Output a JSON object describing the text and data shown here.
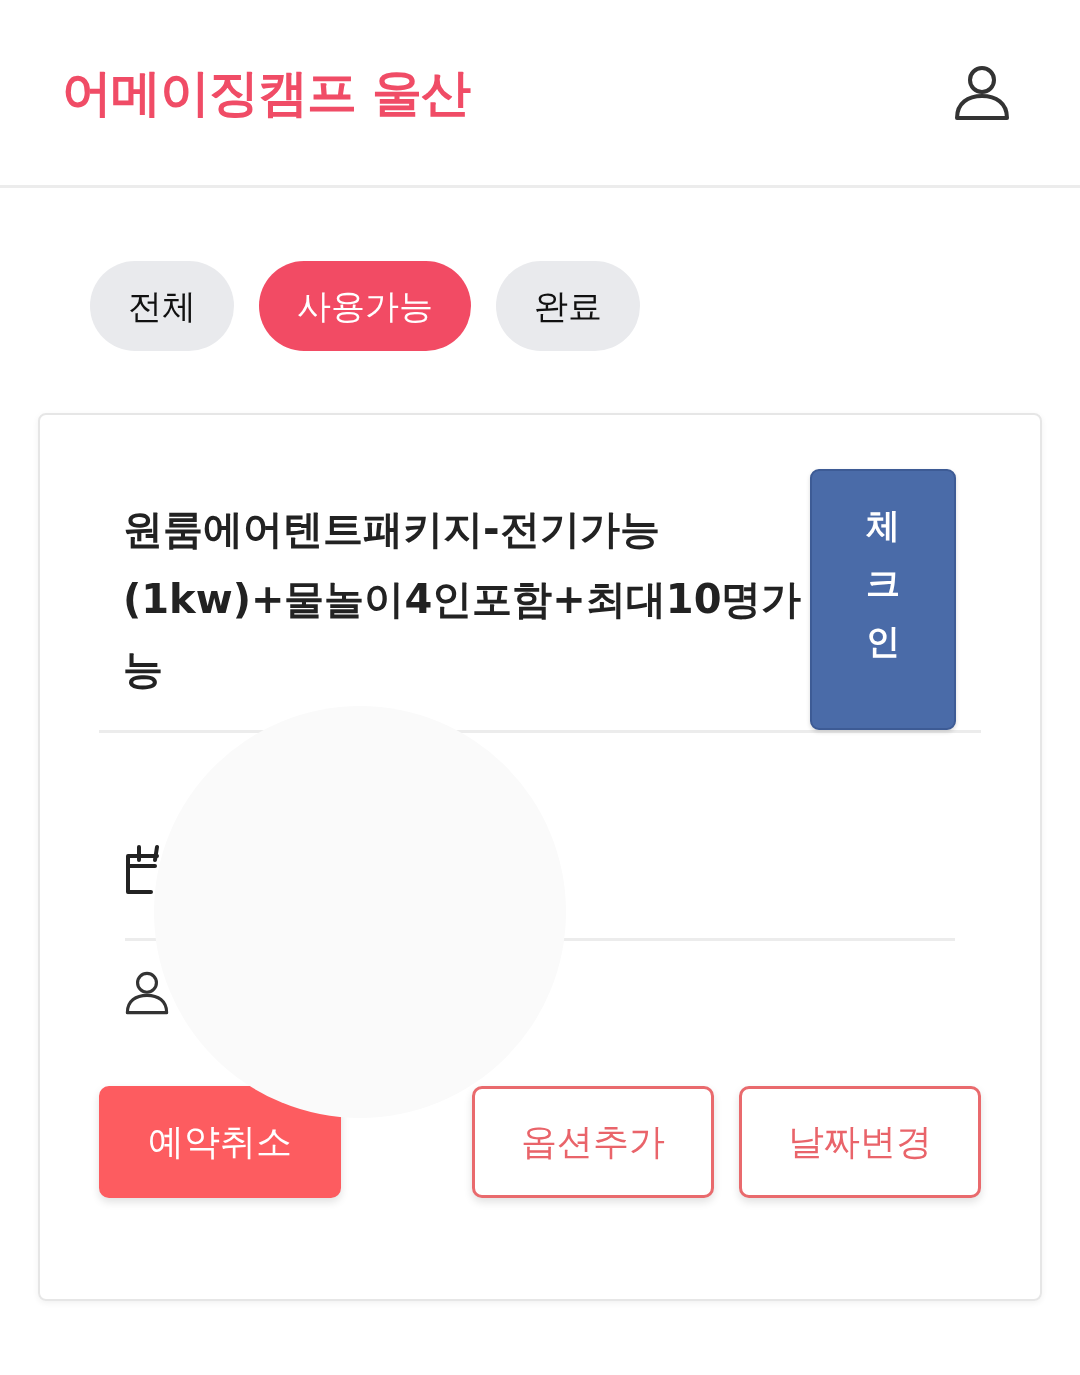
{
  "header": {
    "logo": "어메이징캠프 울산"
  },
  "tabs": [
    {
      "label": "전체",
      "selected": false
    },
    {
      "label": "사용가능",
      "selected": true
    },
    {
      "label": "완료",
      "selected": false
    }
  ],
  "booking": {
    "title": "원룸에어텐트패키지-전기가능(1kw)+물놀이4인포함+최대10명가능",
    "check_in": "체크인",
    "actions": [
      {
        "label": "예약취소",
        "kind": "filled"
      },
      {
        "label": "옵션추가",
        "kind": "outline"
      },
      {
        "label": "날짜변경",
        "kind": "outline"
      }
    ]
  }
}
